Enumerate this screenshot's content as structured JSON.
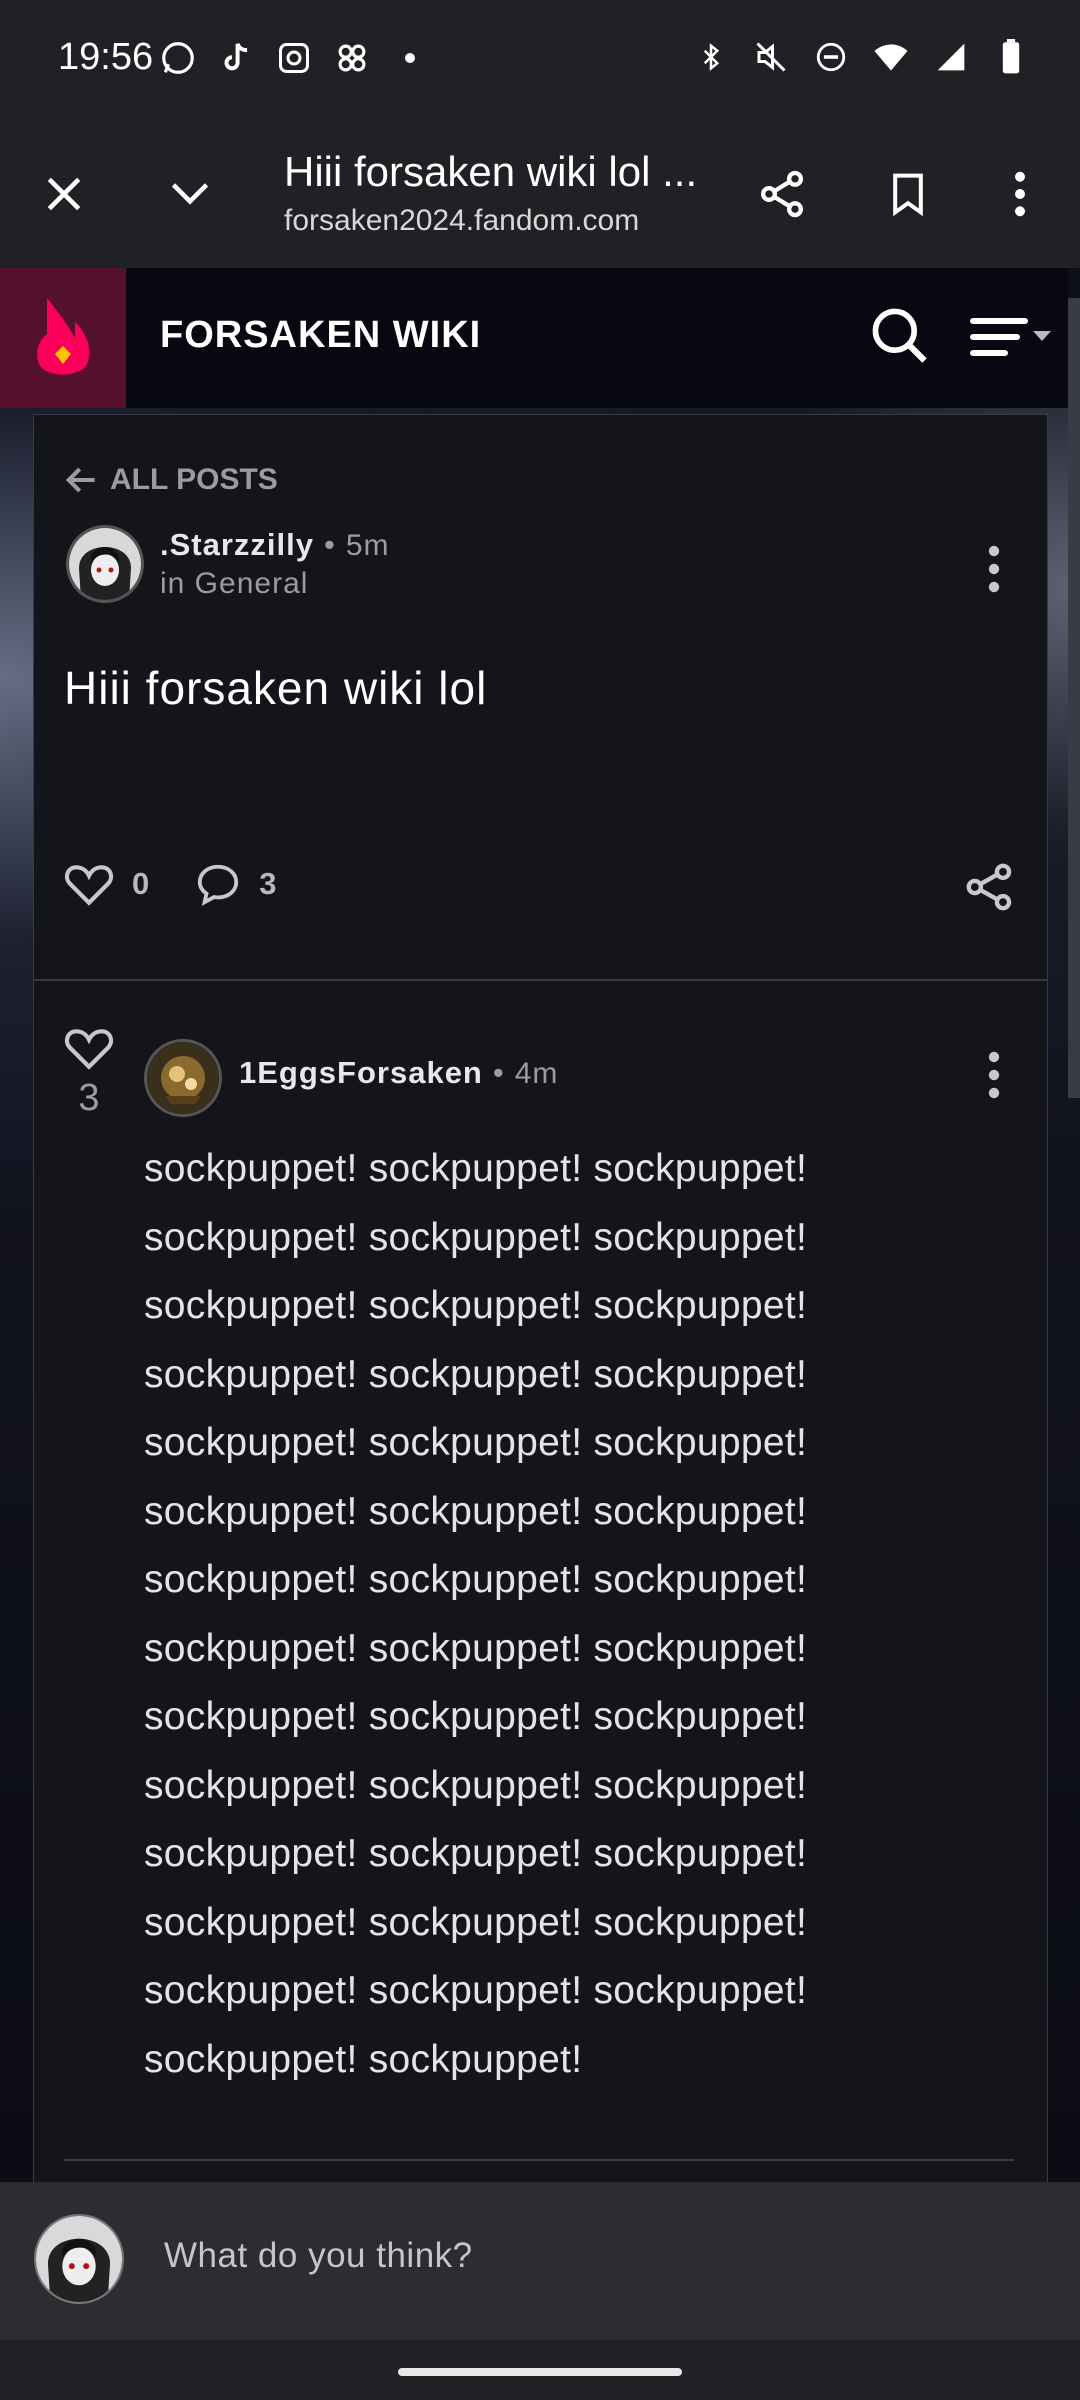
{
  "status_bar": {
    "time": "19:56",
    "notification_icons": [
      "whatsapp-icon",
      "tiktok-icon",
      "instagram-icon",
      "threads-icon",
      "dot-icon"
    ],
    "system_icons": [
      "bluetooth-icon",
      "mute-icon",
      "dnd-icon",
      "wifi-icon",
      "signal-icon",
      "battery-icon"
    ]
  },
  "browser": {
    "title": "Hiii forsaken wiki lol ...",
    "url": "forsaken2024.fandom.com"
  },
  "wiki": {
    "name": "FORSAKEN WIKI"
  },
  "post": {
    "back_label": "ALL POSTS",
    "author": ".Starzzilly",
    "separator": "•",
    "time": "5m",
    "category": "in General",
    "title": "Hiii forsaken wiki lol",
    "likes": "0",
    "comments": "3"
  },
  "reply": {
    "likes": "3",
    "author": "1EggsForsaken",
    "separator": "•",
    "time": "4m",
    "lines": [
      "sockpuppet! sockpuppet! sockpuppet!",
      "sockpuppet! sockpuppet! sockpuppet!",
      "sockpuppet! sockpuppet! sockpuppet!",
      "sockpuppet! sockpuppet! sockpuppet!",
      "sockpuppet! sockpuppet! sockpuppet!",
      "sockpuppet! sockpuppet! sockpuppet!",
      "sockpuppet! sockpuppet! sockpuppet!",
      "sockpuppet! sockpuppet! sockpuppet!",
      "sockpuppet! sockpuppet! sockpuppet!",
      "sockpuppet! sockpuppet! sockpuppet!",
      "sockpuppet! sockpuppet! sockpuppet!",
      "sockpuppet! sockpuppet! sockpuppet!",
      "sockpuppet! sockpuppet! sockpuppet!",
      "sockpuppet! sockpuppet!"
    ]
  },
  "composer": {
    "placeholder": "What do you think?"
  },
  "colors": {
    "fandom_accent": "#fa005a",
    "logo_bg": "#55102b",
    "card_bg": "#14151a"
  }
}
